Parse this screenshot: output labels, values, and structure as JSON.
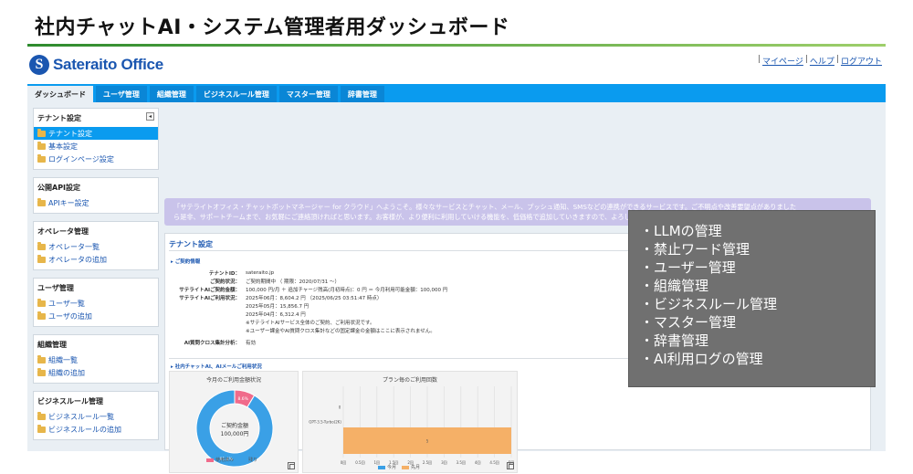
{
  "page_title": "社内チャットAI・システム管理者用ダッシュボード",
  "logo": {
    "mark": "S",
    "text": "Sateraito Office",
    "color": "#1a56b0"
  },
  "top_links": [
    "マイページ",
    "ヘルプ",
    "ログアウト"
  ],
  "tabs": [
    {
      "label": "ダッシュボード",
      "active": true
    },
    {
      "label": "ユーザ管理",
      "active": false
    },
    {
      "label": "組織管理",
      "active": false
    },
    {
      "label": "ビジネスルール管理",
      "active": false
    },
    {
      "label": "マスター管理",
      "active": false
    },
    {
      "label": "辞書管理",
      "active": false
    }
  ],
  "sidebar": {
    "collapse_glyph": "◂",
    "groups": [
      {
        "title": "テナント設定",
        "items": [
          {
            "label": "テナント設定",
            "active": true
          },
          {
            "label": "基本設定",
            "active": false
          },
          {
            "label": "ログインページ設定",
            "active": false
          }
        ]
      },
      {
        "title": "公開API設定",
        "items": [
          {
            "label": "APIキー設定",
            "active": false
          }
        ]
      },
      {
        "title": "オペレータ管理",
        "items": [
          {
            "label": "オペレータ一覧",
            "active": false
          },
          {
            "label": "オペレータの追加",
            "active": false
          }
        ]
      },
      {
        "title": "ユーザ管理",
        "items": [
          {
            "label": "ユーザ一覧",
            "active": false
          },
          {
            "label": "ユーザの追加",
            "active": false
          }
        ]
      },
      {
        "title": "組織管理",
        "items": [
          {
            "label": "組織一覧",
            "active": false
          },
          {
            "label": "組織の追加",
            "active": false
          }
        ]
      },
      {
        "title": "ビジネスルール管理",
        "items": [
          {
            "label": "ビジネスルール一覧",
            "active": false
          },
          {
            "label": "ビジネスルールの追加",
            "active": false
          }
        ]
      }
    ]
  },
  "notice": {
    "line1": "「サテライトオフィス・チャットボットマネージャー for クラウド」へようこそ。様々なサービスとチャット、メール、プッシュ通知、SMSなどの連携ができるサービスです。ご不明点や改善要望点がありました",
    "line2": "ら是非、サポートチームまで、お気軽にご連絡頂ければと思います。お客様が、より便利に利用していける機能を、低価格で追加していきますので、よろしくお願いします。"
  },
  "panel": {
    "title": "テナント設定",
    "contract_section": "ご契約情報",
    "usage_section": "社内チャットAI、AIメールご利用状況",
    "info": [
      {
        "label": "テナントID：",
        "value": "sateraito.jp"
      },
      {
        "label": "ご契約状況：",
        "value": "ご契約期間中 （ 期限：2020/07/31 ～）"
      },
      {
        "label": "サテライトAIご契約金額：",
        "value": "100,000 円/月 ＋ 追加チャージ残高(月初時点)：0 円 ＝ 今月利用可能金額：100,000 円"
      },
      {
        "label": "サテライトAIご利用状況：",
        "value": "2025年06月：8,604.2 円 （2025/06/25 03:51:47 時点）"
      },
      {
        "label": "",
        "value": "2025年05月：15,856.7 円"
      },
      {
        "label": "",
        "value": "2025年04月：6,312.4 円"
      },
      {
        "label": "",
        "value": "※サテライトAIサービス全体のご契約、ご利用状況です。"
      },
      {
        "label": "",
        "value": "※ユーザー課金やAI質問クロス集計などの固定課金の金額はここに表示されません。"
      },
      {
        "label": "AI質問クロス集計分析：",
        "value": "有効"
      }
    ]
  },
  "chart_data": [
    {
      "type": "pie",
      "title": "今月のご利用金額状況",
      "center_label": "ご契約金額",
      "center_value": "100,000円",
      "slices": [
        {
          "name": "使用済み",
          "value": 8.6,
          "label": "8.6%",
          "color": "#f06b8b"
        },
        {
          "name": "残り",
          "value": 91.4,
          "label": "91.4%",
          "color": "#3aa0e6"
        }
      ]
    },
    {
      "type": "bar",
      "orientation": "horizontal",
      "title": "プラン毎のご利用回数",
      "categories": [
        "GPT-3.5-Turbo(2K)"
      ],
      "series": [
        {
          "name": "今月",
          "values": [
            0
          ],
          "color": "#3aa0e6"
        },
        {
          "name": "先月",
          "values": [
            5
          ],
          "color": "#f5b067"
        }
      ],
      "data_labels": [
        "0",
        "5"
      ],
      "xticks": [
        "0回",
        "0.5回",
        "1回",
        "1.5回",
        "2回",
        "2.5回",
        "3回",
        "3.5回",
        "4回",
        "4.5回",
        "5回"
      ],
      "xlim": [
        0,
        5
      ]
    }
  ],
  "overlay": {
    "items": [
      "・LLMの管理",
      "・禁止ワード管理",
      "・ユーザー管理",
      "・組織管理",
      "・ビジネスルール管理",
      "・マスター管理",
      "・辞書管理",
      "・AI利用ログの管理"
    ]
  }
}
